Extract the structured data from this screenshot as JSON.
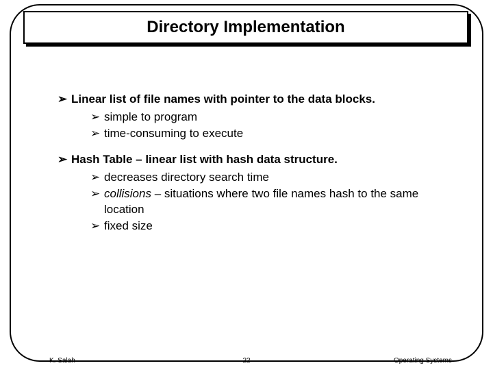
{
  "title": "Directory Implementation",
  "bullets": {
    "b1": {
      "text": "Linear list of file names with pointer to the data blocks.",
      "sub": {
        "s1": "simple to program",
        "s2": "time-consuming to execute"
      }
    },
    "b2": {
      "text": "Hash Table – linear list with hash data structure.",
      "sub": {
        "s1": "decreases directory search time",
        "s2_pre": "collisions",
        "s2_post": " – situations where two file names hash to the same location",
        "s3": "fixed size"
      }
    }
  },
  "footer": {
    "left": "K. Salah",
    "center": "22",
    "right": "Operating Systems"
  },
  "glyphs": {
    "arrow": "➢"
  }
}
